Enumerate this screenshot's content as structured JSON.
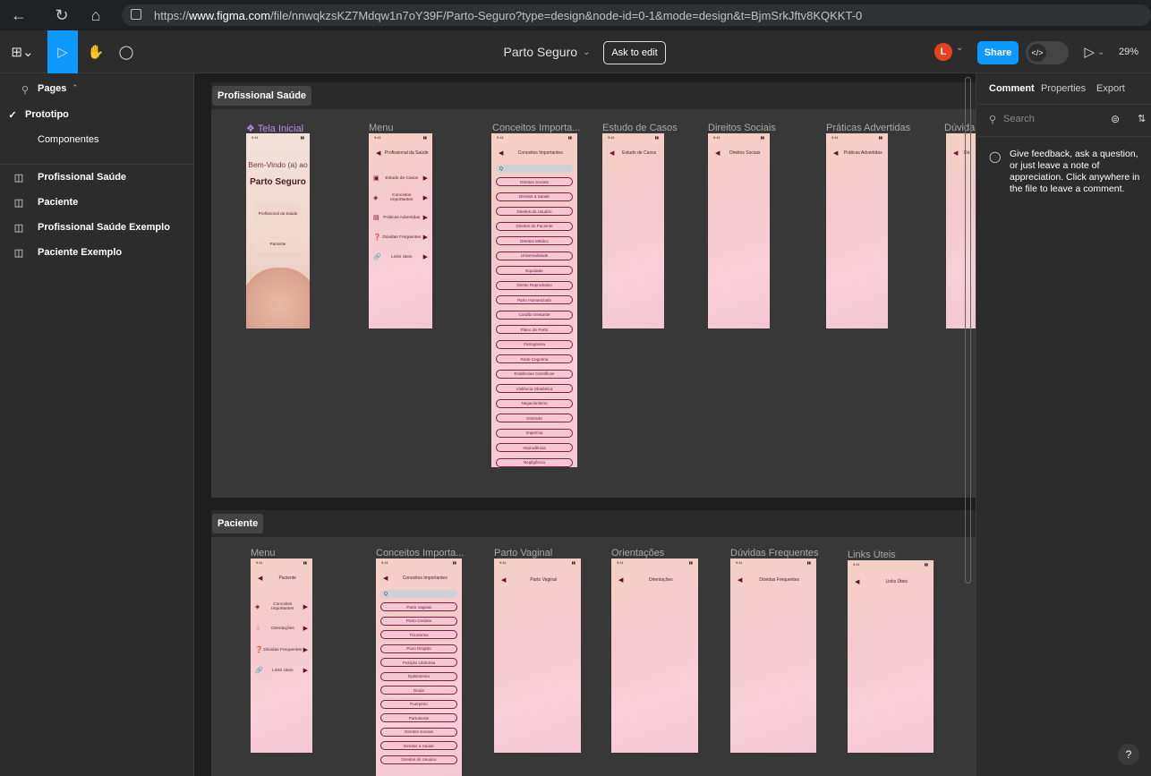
{
  "browser": {
    "url_prefix": "https://",
    "url_domain": "www.figma.com",
    "url_rest": "/file/nnwqkzsKZ7Mdqw1n7oY39F/Parto-Seguro?type=design&node-id=0-1&mode=design&t=BjmSrkJftv8KQKKT-0"
  },
  "toolbar": {
    "file_name": "Parto Seguro",
    "ask_to_edit": "Ask to edit",
    "avatar_letter": "L",
    "share": "Share",
    "zoom": "29%",
    "accent": "#0d99ff"
  },
  "left_panel": {
    "pages_label": "Pages",
    "pages": [
      {
        "label": "Prototipo",
        "checked": true
      },
      {
        "label": "Componentes",
        "checked": false
      }
    ],
    "layers": [
      "Profissional Saúde",
      "Paciente",
      "Profissional Saúde Exemplo",
      "Paciente Exemplo"
    ]
  },
  "right_panel": {
    "tabs": [
      "Comment",
      "Properties",
      "Export"
    ],
    "search_placeholder": "Search",
    "comment_hint": "Give feedback, ask a question, or just leave a note of appreciation. Click anywhere in the file to leave a comment.",
    "help": "?"
  },
  "canvas": {
    "section1": {
      "label": "Profissional Saúde",
      "frames": [
        {
          "title": "Tela Inicial"
        },
        {
          "title": "Menu"
        },
        {
          "title": "Conceitos Importa..."
        },
        {
          "title": "Estudo de Casos"
        },
        {
          "title": "Direitos Sociais"
        },
        {
          "title": "Práticas Advertidas"
        },
        {
          "title": "Dúvida"
        }
      ],
      "home": {
        "welcome": "Bem-Vindo (a) ao",
        "app_name": "Parto Seguro",
        "btn1": "Profissional da Saúde",
        "btn2": "Paciente"
      },
      "menu": {
        "header": "Profissional da Saúde",
        "items": [
          "Estudo de Casos",
          "Conceitos Importantes",
          "Práticas Advertidas",
          "Dúvidas Frequentes",
          "Links Úteis"
        ]
      },
      "conceitos": {
        "header": "Conceitos Importantes",
        "search": "Q",
        "items": [
          "Direitos Sociais",
          "Direitos à Saúde",
          "Direitos do Usuário",
          "Direitos do Paciente",
          "Direitos Médico",
          "Universalidade",
          "Equidade",
          "Direito Reprodutivo",
          "Parto Humanizado",
          "Cordão Gestante",
          "Plano de Parto",
          "Partograma",
          "Rede Cegonha",
          "Evidências Científicas",
          "Violência Obstétrica",
          "Negacionismo",
          "Omissão",
          "Imperícia",
          "Imprudência",
          "Negligência"
        ]
      },
      "simple_headers": [
        "Estudo de Casos",
        "Direitos Sociais",
        "Práticas Advertidas",
        "Dú"
      ]
    },
    "section2": {
      "label": "Paciente",
      "frames": [
        {
          "title": "Menu"
        },
        {
          "title": "Conceitos Importa..."
        },
        {
          "title": "Parto Vaginal"
        },
        {
          "title": "Orientações"
        },
        {
          "title": "Dúvidas Frequentes"
        },
        {
          "title": "Links Úteis"
        }
      ],
      "menu": {
        "header": "Paciente",
        "items": [
          "Conceitos Importantes",
          "Orientações",
          "Dúvidas Frequentes",
          "Links Úteis"
        ]
      },
      "conceitos": {
        "header": "Conceitos Importantes",
        "search": "Q",
        "items": [
          "Parto Vaginal",
          "Parto Cesária",
          "Tricotomia",
          "Puxo Dirigido",
          "Posição Litotomia",
          "Episiotomia",
          "Doula",
          "Puerpério",
          "Parturiente",
          "Direitos Sociais",
          "Direitos à Saúde",
          "Direitos do Usuário"
        ]
      },
      "simple_headers": [
        "Parto Vaginal",
        "Orientações",
        "Dúvidas Frequentes",
        "Links Úteis"
      ]
    }
  },
  "status_time": "9:41"
}
